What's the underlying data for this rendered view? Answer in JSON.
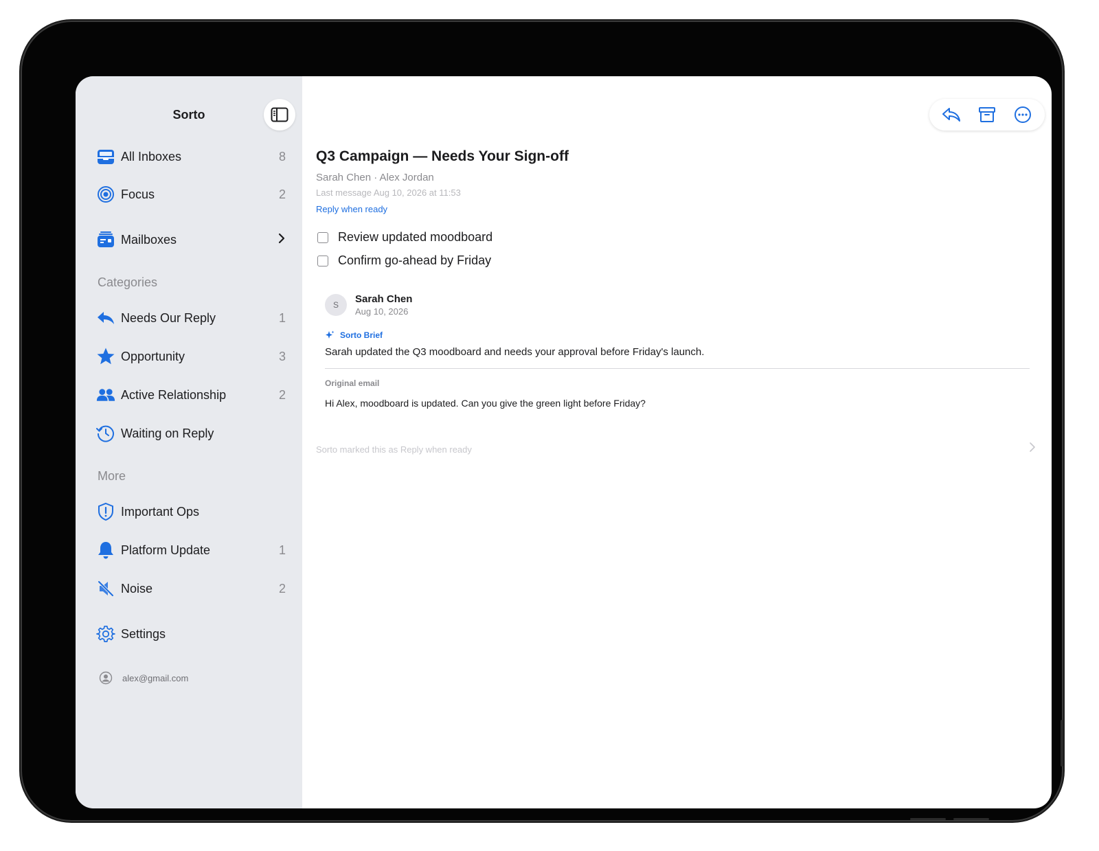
{
  "sidebar": {
    "title": "Sorto",
    "items": [
      {
        "label": "All Inboxes",
        "count": "8",
        "icon": "tray-icon"
      },
      {
        "label": "Focus",
        "count": "2",
        "icon": "target-icon"
      },
      {
        "label": "Mailboxes",
        "icon": "mailbox-icon"
      }
    ],
    "categories_heading": "Categories",
    "categories": [
      {
        "label": "Needs Our Reply",
        "count": "1",
        "icon": "reply-icon"
      },
      {
        "label": "Opportunity",
        "count": "3",
        "icon": "star-icon"
      },
      {
        "label": "Active Relationship",
        "count": "2",
        "icon": "people-icon"
      },
      {
        "label": "Waiting on Reply",
        "count": "",
        "icon": "clock-history-icon"
      }
    ],
    "more_heading": "More",
    "more": [
      {
        "label": "Important Ops",
        "count": "",
        "icon": "shield-alert-icon"
      },
      {
        "label": "Platform Update",
        "count": "1",
        "icon": "bell-icon"
      },
      {
        "label": "Noise",
        "count": "2",
        "icon": "muted-speaker-icon"
      }
    ],
    "settings_label": "Settings",
    "account": "alex@gmail.com"
  },
  "thread": {
    "subject": "Q3 Campaign — Needs Your Sign-off",
    "participants": "Sarah Chen · Alex Jordan",
    "last_message": "Last message Aug 10, 2026 at 11:53",
    "status_tag": "Reply when ready",
    "todos": [
      {
        "label": "Review updated moodboard",
        "checked": false
      },
      {
        "label": "Confirm go-ahead by Friday",
        "checked": false
      }
    ],
    "message": {
      "avatar_initial": "S",
      "sender": "Sarah Chen",
      "date": "Aug 10, 2026",
      "brief_label": "Sorto Brief",
      "brief_text": "Sarah updated the Q3 moodboard and needs your approval before Friday's launch.",
      "original_label": "Original email",
      "original_text": "Hi Alex, moodboard is updated. Can you give the green light before Friday?"
    },
    "footer_note": "Sorto marked this as Reply when ready"
  },
  "colors": {
    "accent": "#1f6fe0",
    "sidebar_bg": "#e8eaee",
    "muted_text": "#8a8a8e"
  }
}
